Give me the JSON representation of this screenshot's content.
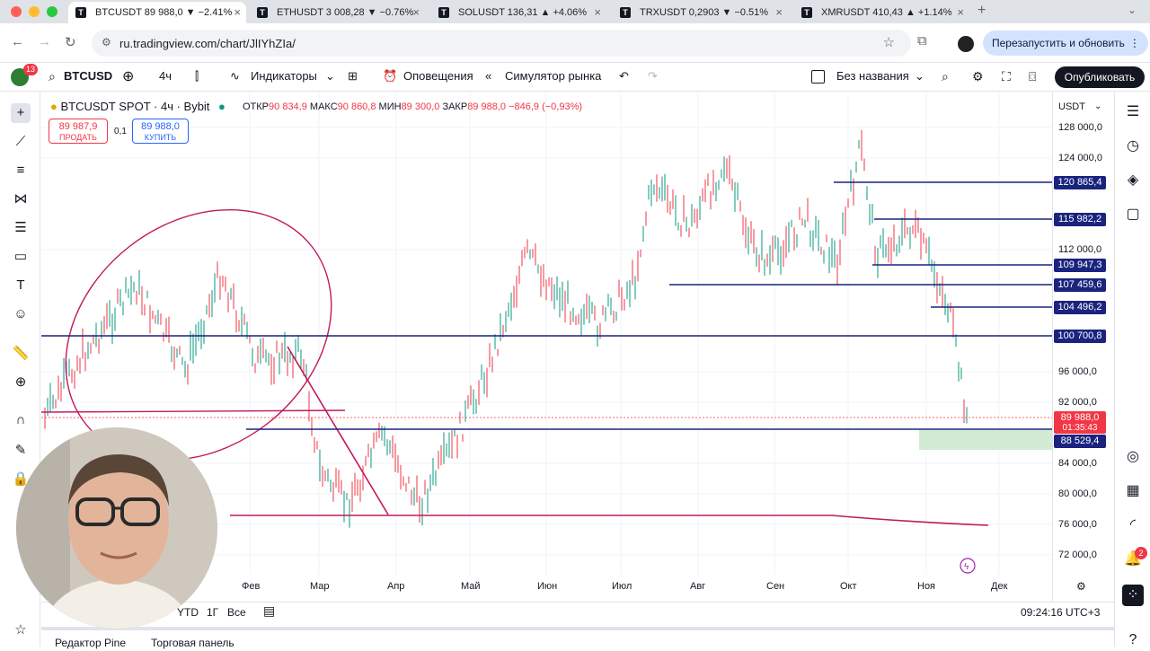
{
  "browser": {
    "tabs": [
      {
        "label": "BTCUSDT 89 988,0 ▼ −2.41%",
        "active": true
      },
      {
        "label": "ETHUSDT 3 008,28 ▼ −0.76%",
        "active": false
      },
      {
        "label": "SOLUSDT 136,31 ▲ +4.06%",
        "active": false
      },
      {
        "label": "TRXUSDT 0,2903 ▼ −0.51%",
        "active": false
      },
      {
        "label": "XMRUSDT 410,43 ▲ +1.14%",
        "active": false
      }
    ],
    "url": "ru.tradingview.com/chart/JlIYhZIa/",
    "restart_label": "Перезапустить и обновить"
  },
  "toolbar": {
    "notification_count": "13",
    "symbol": "BTCUSD",
    "interval": "4ч",
    "indicators": "Индикаторы",
    "alerts": "Оповещения",
    "replay": "Симулятор рынка",
    "layout_name": "Без названия",
    "publish": "Опубликовать"
  },
  "legend": {
    "title": "BTCUSDT SPOT · 4ч · Bybit",
    "open_label": "ОТКР",
    "open": "90 834,9",
    "high_label": "МАКС",
    "high": "90 860,8",
    "low_label": "МИН",
    "low": "89 300,0",
    "close_label": "ЗАКР",
    "close": "89 988,0",
    "change": "−846,9 (−0,93%)"
  },
  "trade": {
    "sell_price": "89 987,9",
    "sell_label": "ПРОДАТЬ",
    "spread": "0,1",
    "buy_price": "89 988,0",
    "buy_label": "КУПИТЬ"
  },
  "price_axis": {
    "currency": "USDT",
    "ticks": [
      "128 000,0",
      "124 000,0",
      "112 000,0",
      "96 000,0",
      "92 000,0",
      "84 000,0",
      "80 000,0",
      "76 000,0",
      "72 000,0"
    ],
    "levels": [
      "120 865,4",
      "115 982,2",
      "109 947,3",
      "107 459,6",
      "104 496,2",
      "100 700,8",
      "88 529,4"
    ],
    "current_price": "89 988,0",
    "countdown": "01:35:43"
  },
  "time_axis": {
    "ticks": [
      "Фев",
      "Мар",
      "Апр",
      "Май",
      "Июн",
      "Июл",
      "Авг",
      "Сен",
      "Окт",
      "Ноя",
      "Дек"
    ]
  },
  "bottom": {
    "ranges": [
      "YTD",
      "1Г",
      "Все"
    ],
    "clock": "09:24:16 UTC+3",
    "pine_editor": "Редактор Pine",
    "trading_panel": "Торговая панель"
  },
  "right_panel": {
    "notifications_badge": "2"
  },
  "colors": {
    "level_line": "#1a237e",
    "drawing_red": "#c2185b",
    "down": "#f23645",
    "up": "#089981",
    "zone": "#c8e6c9"
  }
}
